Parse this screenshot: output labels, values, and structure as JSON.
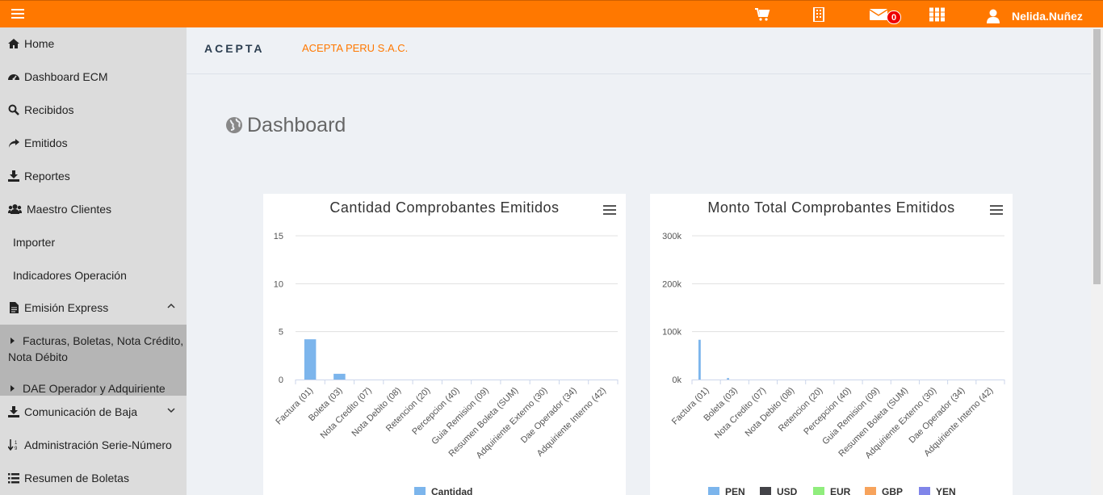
{
  "topbar": {
    "user_name": "Nelida.Nuñez",
    "mail_count": "0",
    "icons": [
      "menu-icon",
      "cart-icon",
      "building-icon",
      "envelope-icon",
      "grid-icon",
      "user-icon"
    ],
    "accent_color": "#ff7800"
  },
  "sidebar": {
    "items": [
      {
        "label": "Home",
        "icon": "home-icon"
      },
      {
        "label": "Dashboard ECM",
        "icon": "dashboard-icon"
      },
      {
        "label": "Recibidos",
        "icon": "search-icon"
      },
      {
        "label": "Emitidos",
        "icon": "share-icon"
      },
      {
        "label": "Reportes",
        "icon": "download-icon"
      },
      {
        "label": "Maestro Clientes",
        "icon": "users-icon"
      },
      {
        "label": "Importer"
      },
      {
        "label": "Indicadores Operación"
      },
      {
        "label": "Emisión Express",
        "icon": "file-icon"
      },
      {
        "label": "Comunicación de Baja",
        "icon": "download-icon"
      },
      {
        "label": "Administración Serie-Número",
        "icon": "sort-icon"
      },
      {
        "label": "Resumen de Boletas",
        "icon": "list-icon"
      }
    ],
    "submenu": [
      {
        "label": "Facturas, Boletas, Nota Crédito, Nota Débito"
      },
      {
        "label": "DAE Operador y Adquiriente"
      }
    ]
  },
  "header": {
    "logo": "ACEPTA",
    "company": "ACEPTA PERU S.A.C."
  },
  "page": {
    "title": "Dashboard"
  },
  "chart_data": [
    {
      "type": "bar",
      "title": "Cantidad Comprobantes Emitidos",
      "categories": [
        "Factura (01)",
        "Boleta (03)",
        "Nota Credito (07)",
        "Nota Debito (08)",
        "Retencion (20)",
        "Percepcion (40)",
        "Guia Remision (09)",
        "Resumen Boleta (SUM)",
        "Adquiriente Externo (30)",
        "Dae Operador (34)",
        "Adquiriente Interno (42)"
      ],
      "series": [
        {
          "name": "Cantidad",
          "color": "#7cb5ec",
          "values": [
            4.2,
            0.6,
            0,
            0,
            0,
            0,
            0,
            0,
            0,
            0,
            0
          ]
        }
      ],
      "yticks": [
        "0",
        "5",
        "10",
        "15"
      ],
      "ylim": [
        0,
        15
      ],
      "grid": true,
      "legend": "bottom"
    },
    {
      "type": "bar",
      "title": "Monto Total Comprobantes Emitidos",
      "categories": [
        "Factura (01)",
        "Boleta (03)",
        "Nota Credito (07)",
        "Nota Debito (08)",
        "Retencion (20)",
        "Percepcion (40)",
        "Guia Remision (09)",
        "Resumen Boleta (SUM)",
        "Adquiriente Externo (30)",
        "Dae Operador (34)",
        "Adquiriente Interno (42)"
      ],
      "series": [
        {
          "name": "PEN",
          "color": "#7cb5ec",
          "values": [
            83000,
            3000,
            0,
            0,
            0,
            0,
            0,
            0,
            0,
            0,
            0
          ]
        },
        {
          "name": "USD",
          "color": "#434348",
          "values": [
            0,
            0,
            0,
            0,
            0,
            0,
            0,
            0,
            0,
            0,
            0
          ]
        },
        {
          "name": "EUR",
          "color": "#90ed7d",
          "values": [
            0,
            0,
            0,
            0,
            0,
            0,
            0,
            0,
            0,
            0,
            0
          ]
        },
        {
          "name": "GBP",
          "color": "#f7a35c",
          "values": [
            0,
            0,
            0,
            0,
            0,
            0,
            0,
            0,
            0,
            0,
            0
          ]
        },
        {
          "name": "YEN",
          "color": "#8085e9",
          "values": [
            0,
            0,
            0,
            0,
            0,
            0,
            0,
            0,
            0,
            0,
            0
          ]
        }
      ],
      "yticks": [
        "0k",
        "100k",
        "200k",
        "300k"
      ],
      "ylim": [
        0,
        300000
      ],
      "grid": true,
      "legend": "bottom"
    }
  ]
}
